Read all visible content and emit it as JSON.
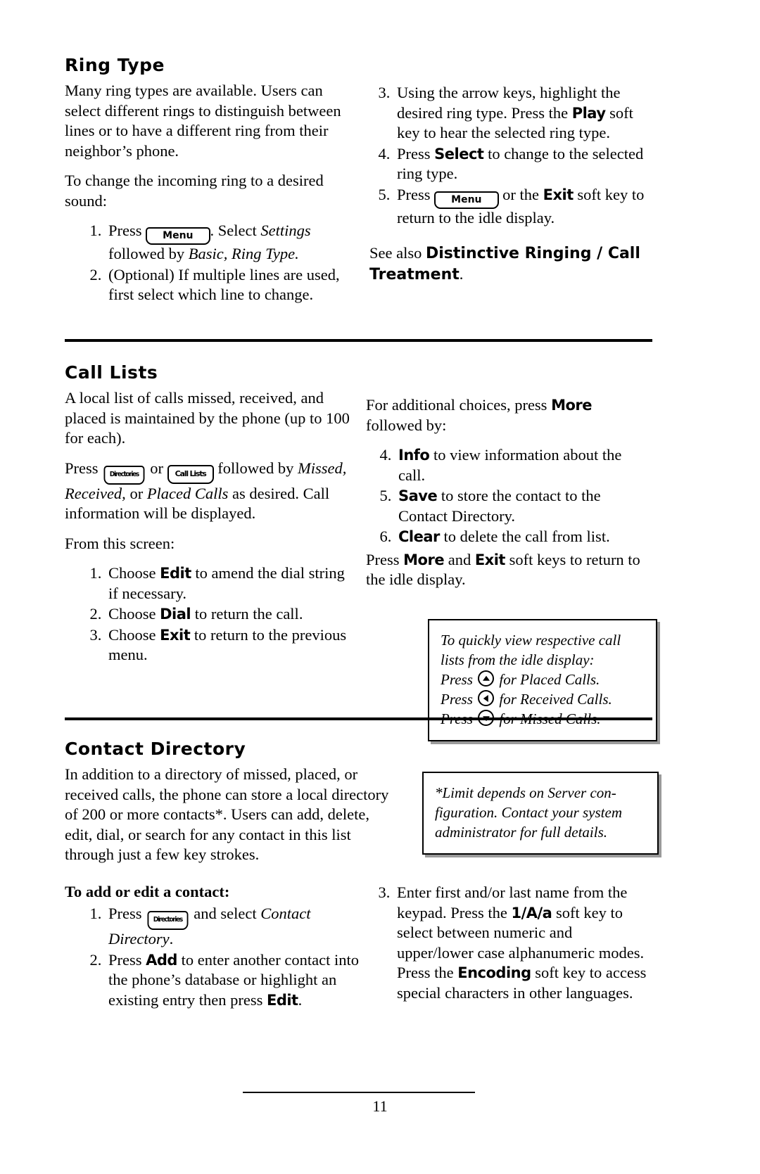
{
  "sections": {
    "ring_type": {
      "title": "Ring Type",
      "left": {
        "p1": "Many ring types are available.  Users can select different rings to distinguish between lines or to have a different ring from their neighbor’s phone.",
        "p2": "To change the incoming ring to a desired sound:",
        "step1_pre": "Press",
        "step1_key": "Menu",
        "step1_mid": ".  Select ",
        "step1_italic1": "Settings",
        "step1_mid2": " followed by ",
        "step1_italic2": "Basic, Ring Type.",
        "step2": "(Optional)  If multiple lines are used, first select which line to change."
      },
      "right": {
        "step3_a": "Using the arrow keys, highlight the desired ring type.  Press the ",
        "step3_key": "Play",
        "step3_b": " soft key to hear the selected ring type.",
        "step4_a": "Press ",
        "step4_key": "Select",
        "step4_b": " to change to the selected ring type.",
        "step5_a": "Press",
        "step5_key_menu": "Menu",
        "step5_b": " or the ",
        "step5_key_exit": "Exit",
        "step5_c": " soft key to return to the idle display.",
        "seealso_pre": "See also ",
        "seealso_bold": "Distinctive Ringing / Call Treatment",
        "seealso_post": "."
      }
    },
    "call_lists": {
      "title": "Call Lists",
      "left": {
        "p1": "A local list of calls missed, received, and placed is maintained by the phone (up to 100 for each).",
        "p2_pre": "Press ",
        "p2_key1": "Directories",
        "p2_or": " or ",
        "p2_key2": "Call Lists",
        "p2_mid": " followed by ",
        "p2_italic": "Missed, Received,",
        "p2_mid2": " or ",
        "p2_italic2": "Placed Calls",
        "p2_post": " as desired.  Call information will be displayed.",
        "p3": "From this screen:",
        "step1_a": "Choose ",
        "step1_key": "Edit",
        "step1_b": " to amend the dial string if necessary.",
        "step2_a": "Choose ",
        "step2_key": "Dial",
        "step2_b": " to return the call.",
        "step3_a": "Choose ",
        "step3_key": "Exit",
        "step3_b": " to return to the previous menu."
      },
      "right": {
        "p1_a": "For additional choices, press ",
        "p1_key": "More",
        "p1_b": " followed by:",
        "step4_key": "Info",
        "step4_b": " to view information about the call.",
        "step5_key": "Save",
        "step5_b": " to store the contact to the Contact Directory.",
        "step6_key": "Clear",
        "step6_b": " to delete the call from list.",
        "p2_a": "Press ",
        "p2_key1": "More",
        "p2_mid": " and ",
        "p2_key2": "Exit",
        "p2_b": " soft keys to return to the idle display.",
        "note": {
          "l1": "To quickly view respective call",
          "l2": "lists from the idle display:",
          "l3_pre": "Press ",
          "l3_icon": "arrow-up-key-icon",
          "l3_post": " for Placed Calls.",
          "l4_pre": "Press ",
          "l4_icon": "arrow-left-key-icon",
          "l4_post": " for Received Calls.",
          "l5_pre": "Press ",
          "l5_icon": "arrow-down-key-icon",
          "l5_post": " for Missed Calls."
        }
      }
    },
    "contact_directory": {
      "title": "Contact Directory",
      "left": {
        "p1": "In addition to a directory of missed, placed, or received calls, the phone can store a local directory of 200 or more contacts*.  Users can add, delete, edit, dial,  or search for any contact in this list through just a few key strokes.",
        "subhead": "To add or edit a contact:",
        "step1_pre": "Press ",
        "step1_key": "Directories",
        "step1_mid": " and select ",
        "step1_italic": "Contact Directory",
        "step1_post": ".",
        "step2_a": "Press ",
        "step2_key": "Add",
        "step2_b": " to enter another contact into the phone’s database or highlight an existing entry then press ",
        "step2_key2": "Edit",
        "step2_c": "."
      },
      "right": {
        "note": {
          "l1": "*Limit depends on Server con-",
          "l2": "figuration.  Contact your system",
          "l3": "administrator for full details."
        },
        "step3_a": "Enter first and/or last name from the keypad.  Press the ",
        "step3_key": "1/A/a",
        "step3_b": " soft key to select between numeric and upper/lower case alphanumeric modes. Press the ",
        "step3_key2": "Encoding",
        "step3_c": " soft key to access special characters in other languages."
      }
    }
  },
  "footer": {
    "page_number": "11"
  }
}
